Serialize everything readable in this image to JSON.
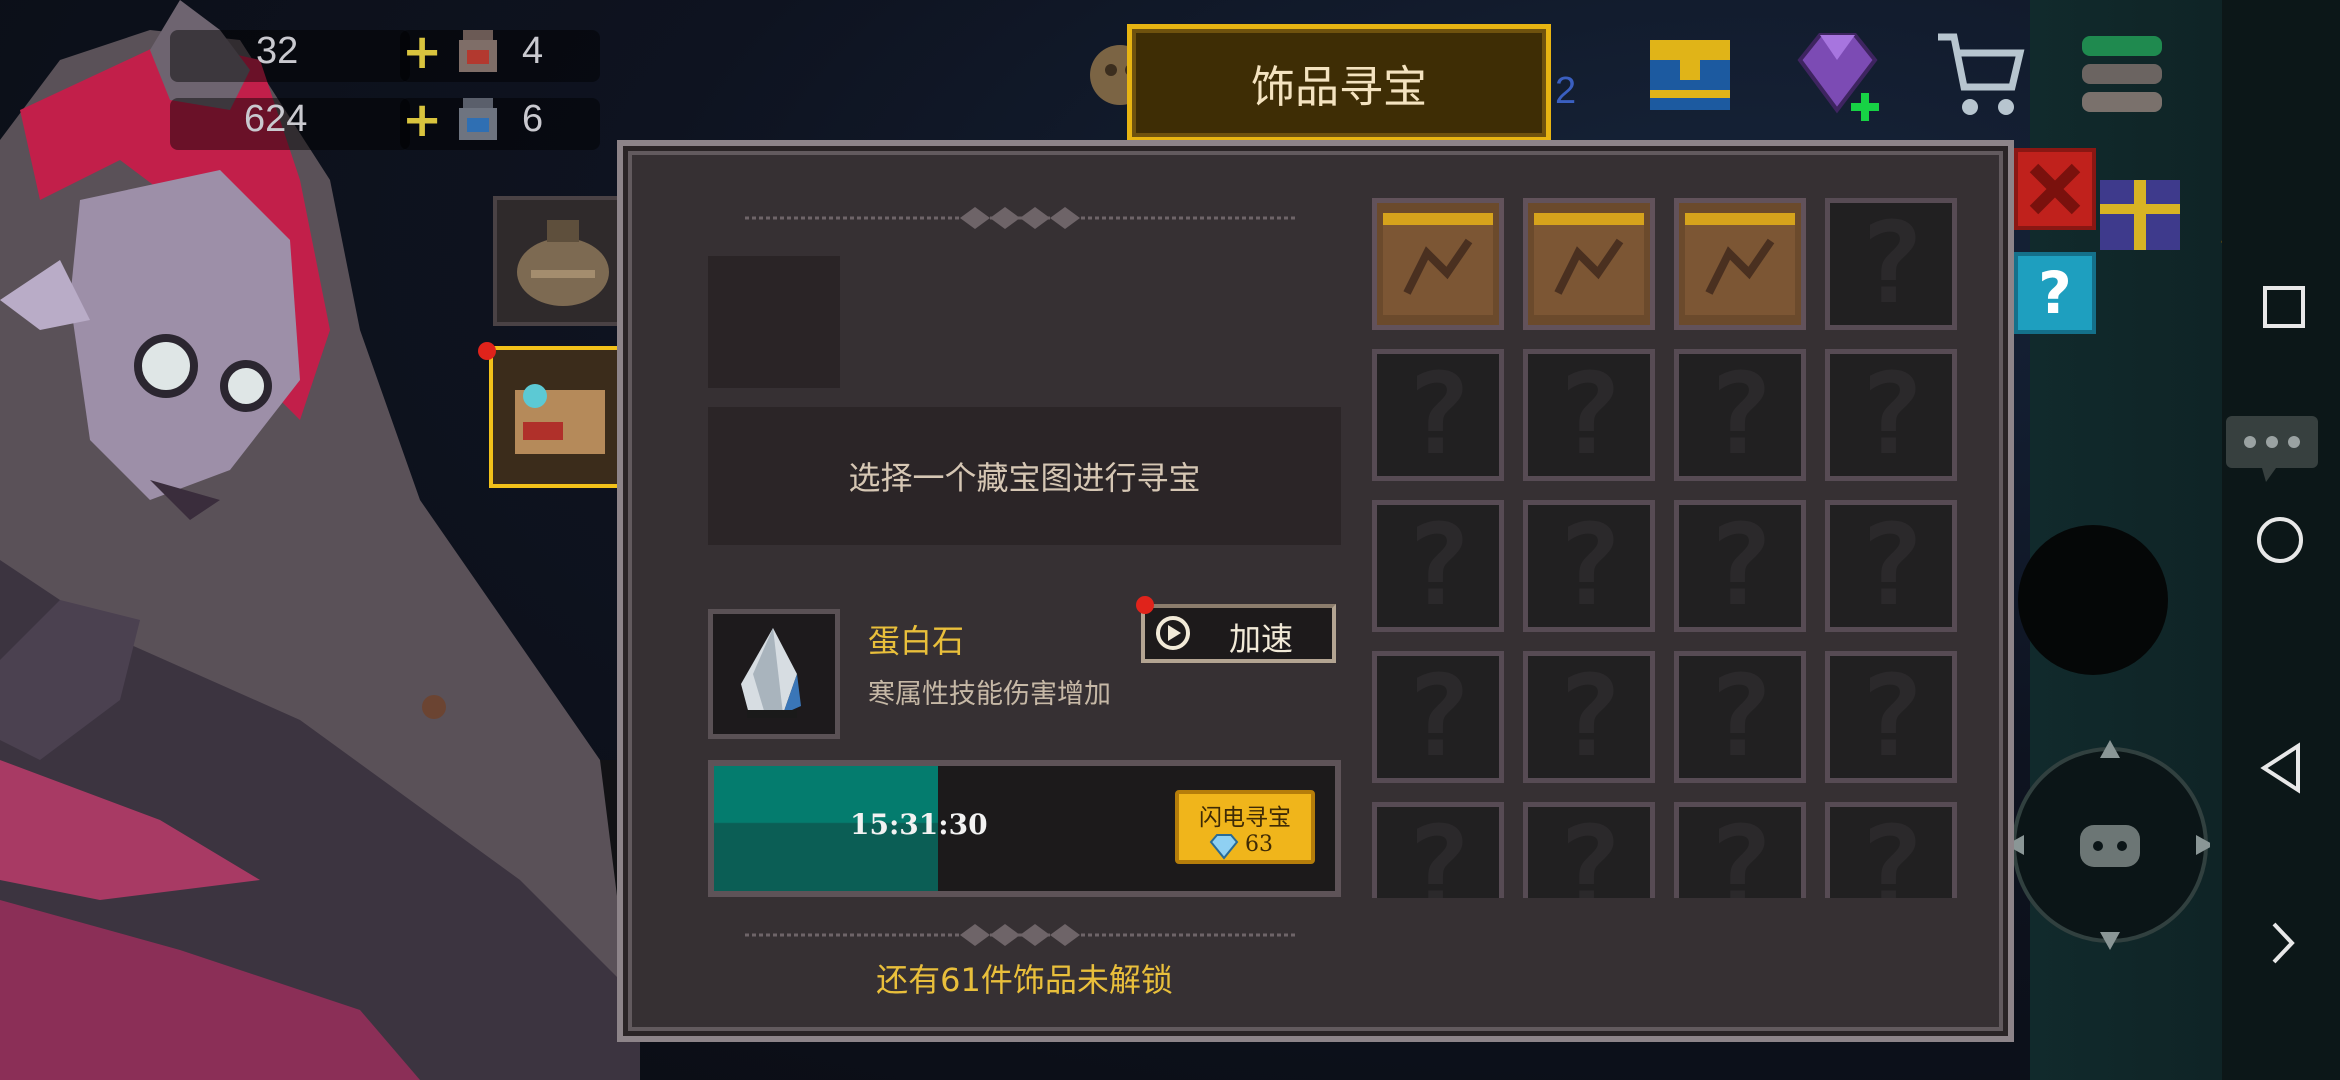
{
  "title": "饰品寻宝",
  "resources": [
    {
      "value": "32",
      "icon": "gem-icon"
    },
    {
      "value": "624",
      "icon": "coin-icon"
    },
    {
      "value": "4",
      "icon": "potion-red-icon"
    },
    {
      "value": "6",
      "icon": "potion-blue-icon"
    }
  ],
  "top_bar": {
    "badge_count": "2",
    "icons": [
      "pet-icon",
      "treasure-chest-icon",
      "diamond-plus-icon",
      "shop-cart-icon",
      "stack-icon",
      "book-icon"
    ]
  },
  "panel": {
    "select_prompt": "选择一个藏宝图进行寻宝",
    "item": {
      "name": "蛋白石",
      "description": "寒属性技能伤害增加",
      "icon": "opal-gem-icon"
    },
    "speed_button": "加速",
    "timer": "15:31:30",
    "progress_fraction": 0.36,
    "flash_button": {
      "label": "闪电寻宝",
      "cost": "63"
    },
    "unlock_text": "还有61件饰品未解锁"
  },
  "grid": {
    "rows": 5,
    "cols": 4,
    "found": [
      {
        "index": 0,
        "icon": "treasure-map-icon"
      },
      {
        "index": 1,
        "icon": "treasure-map-icon"
      },
      {
        "index": 2,
        "icon": "treasure-map-icon"
      }
    ],
    "unknown_symbol": "?"
  },
  "help_symbol": "?",
  "colors": {
    "accent_gold": "#e9bf3b",
    "progress": "#047c6e",
    "panel_bg": "#363033",
    "close_red": "#c0211c",
    "help_blue": "#1e9fbf"
  }
}
